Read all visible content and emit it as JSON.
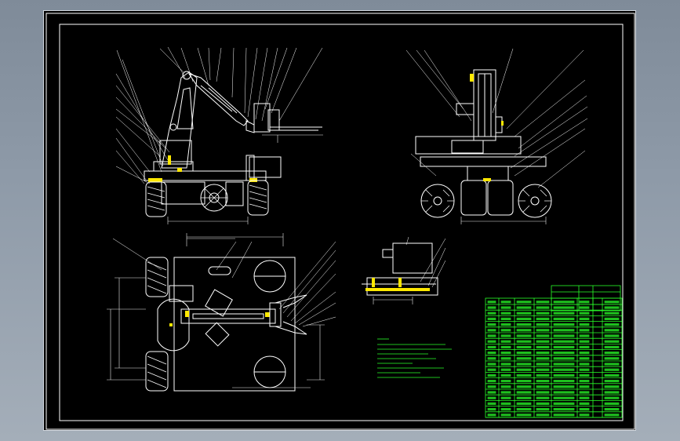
{
  "viewer": {
    "background_color": "#8e9aa8",
    "canvas_color": "#000000",
    "line_color": "#ffffff",
    "highlight_color": "#ffe800",
    "table_color": "#29ff29"
  },
  "drawing": {
    "title_block_label": "",
    "notes_title": ""
  }
}
